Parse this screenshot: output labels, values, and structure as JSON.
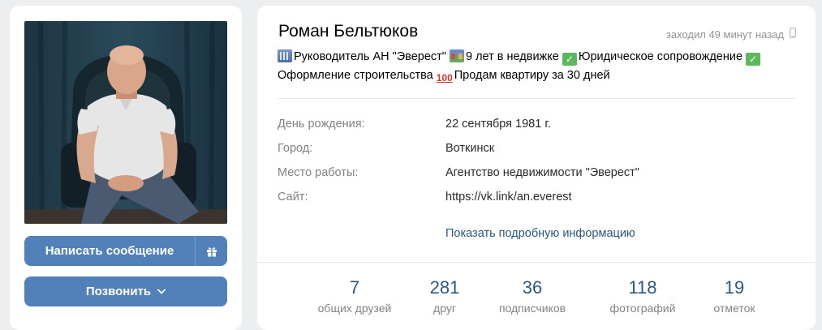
{
  "profile": {
    "name": "Роман Бельтюков",
    "last_seen": "заходил 49 минут назад",
    "status": {
      "part1": "Руководитель АН \"Эверест\" ",
      "part2": "9 лет в недвижке ",
      "part3": "Юридическое сопровождение ",
      "part4": "Оформление строительства ",
      "part5": "Продам квартиру за 30 дней",
      "check_glyph": "✓",
      "hundred_glyph": "100"
    },
    "info": [
      {
        "label": "День рождения:",
        "value": "22 сентября 1981 г."
      },
      {
        "label": "Город:",
        "value": "Воткинск"
      },
      {
        "label": "Место работы:",
        "value": "Агентство недвижимости \"Эверест\""
      },
      {
        "label": "Сайт:",
        "value": "https://vk.link/an.everest"
      }
    ],
    "show_more": "Показать подробную информацию"
  },
  "actions": {
    "message_label": "Написать сообщение",
    "call_label": "Позвонить"
  },
  "counters": [
    {
      "num": "7",
      "label": "общих друзей"
    },
    {
      "num": "281",
      "label": "друг"
    },
    {
      "num": "36",
      "label": "подписчиков"
    },
    {
      "num": "118",
      "label": "фотографий"
    },
    {
      "num": "19",
      "label": "отметок"
    }
  ],
  "icons": {
    "last_seen": "mobile-phone-icon",
    "gift": "gift-icon",
    "call_dropdown": "chevron-down-icon"
  },
  "colors": {
    "accent": "#5181b8",
    "link": "#2a5885",
    "muted": "#828282",
    "background": "#edeef0"
  }
}
